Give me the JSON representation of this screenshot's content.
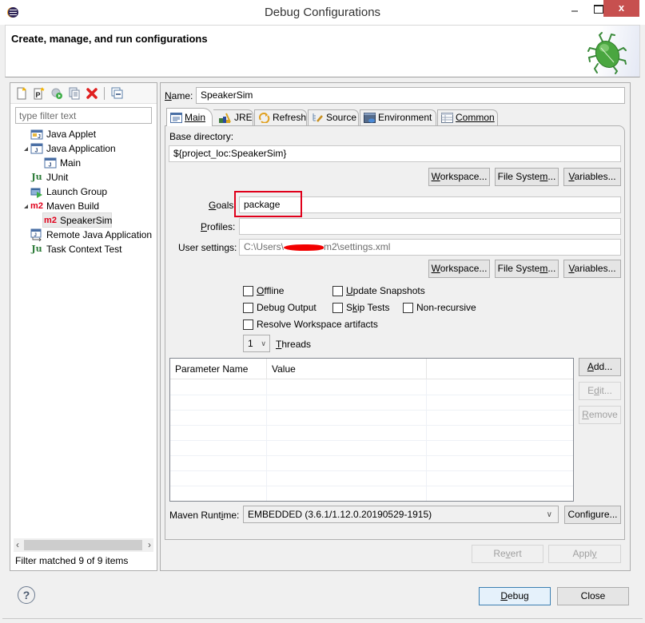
{
  "window": {
    "title": "Debug Configurations",
    "close_glyph": "x"
  },
  "banner": {
    "heading": "Create, manage, and run configurations",
    "icon": "bug-icon"
  },
  "left": {
    "toolbar": [
      {
        "name": "new-configuration-icon"
      },
      {
        "name": "new-prototype-icon"
      },
      {
        "name": "export-configuration-icon"
      },
      {
        "name": "duplicate-configuration-icon"
      },
      {
        "name": "delete-configuration-icon"
      },
      {
        "name": "collapse-all-icon"
      }
    ],
    "filter_placeholder": "type filter text",
    "tree": [
      {
        "label": "Java Applet",
        "icon": "java-applet-icon",
        "level": 0,
        "expandable": false
      },
      {
        "label": "Java Application",
        "icon": "java-application-icon",
        "level": 0,
        "expandable": true,
        "expanded": true
      },
      {
        "label": "Main",
        "icon": "java-application-icon",
        "level": 1
      },
      {
        "label": "JUnit",
        "icon": "junit-icon",
        "icon_text": "Ju",
        "level": 0
      },
      {
        "label": "Launch Group",
        "icon": "launch-group-icon",
        "level": 0
      },
      {
        "label": "Maven Build",
        "icon": "maven-icon",
        "icon_text": "m2",
        "level": 0,
        "expandable": true,
        "expanded": true
      },
      {
        "label": "SpeakerSim",
        "icon": "maven-icon",
        "icon_text": "m2",
        "level": 1,
        "selected": true
      },
      {
        "label": "Remote Java Application",
        "icon": "remote-java-icon",
        "level": 0
      },
      {
        "label": "Task Context Test",
        "icon": "task-context-test-icon",
        "icon_text": "Ju",
        "level": 0
      }
    ],
    "filter_status": "Filter matched 9 of 9 items"
  },
  "right": {
    "name_label": "Name:",
    "name_value": "SpeakerSim",
    "tabs": [
      {
        "label": "Main",
        "icon": "main-tab-icon",
        "active": true
      },
      {
        "label": "JRE",
        "icon": "jre-icon"
      },
      {
        "label": "Refresh",
        "icon": "refresh-icon"
      },
      {
        "label": "Source",
        "icon": "source-icon"
      },
      {
        "label": "Environment",
        "icon": "environment-icon"
      },
      {
        "label": "Common",
        "icon": "common-icon"
      }
    ],
    "base_directory_label": "Base directory:",
    "base_directory_value": "${project_loc:SpeakerSim}",
    "buttons_row1": {
      "workspace": "Workspace...",
      "filesystem": "File System...",
      "variables": "Variables..."
    },
    "goals_label": "Goals:",
    "goals_value": "package",
    "profiles_label": "Profiles:",
    "profiles_value": "",
    "user_settings_label": "User settings:",
    "user_settings_value": "C:\\Users\\[redacted]\\.m2\\settings.xml",
    "user_settings_prefix": "C:\\Users\\",
    "user_settings_suffix": "m2\\settings.xml",
    "buttons_row2": {
      "workspace": "Workspace...",
      "filesystem": "File System...",
      "variables": "Variables..."
    },
    "checkboxes": [
      {
        "label": "Offline",
        "checked": false
      },
      {
        "label": "Update Snapshots",
        "checked": false
      },
      {
        "label": "Debug Output",
        "checked": false
      },
      {
        "label": "Skip Tests",
        "checked": false
      },
      {
        "label": "Non-recursive",
        "checked": false
      },
      {
        "label": "Resolve Workspace artifacts",
        "checked": false
      }
    ],
    "threads_value": "1",
    "threads_label": "Threads",
    "param_table": {
      "columns": [
        "Parameter Name",
        "Value",
        ""
      ],
      "rows": []
    },
    "param_buttons": {
      "add": "Add...",
      "edit": "Edit...",
      "remove": "Remove"
    },
    "maven_runtime_label": "Maven Runtime:",
    "maven_runtime_value": "EMBEDDED (3.6.1/1.12.0.20190529-1915)",
    "configure_label": "Configure...",
    "revert_label": "Revert",
    "apply_label": "Apply"
  },
  "footer": {
    "debug_label": "Debug",
    "close_label": "Close",
    "help_glyph": "?"
  },
  "colors": {
    "highlight_box": "#e0001b",
    "close_button": "#c7504f",
    "default_button_border": "#3c7fb1"
  }
}
